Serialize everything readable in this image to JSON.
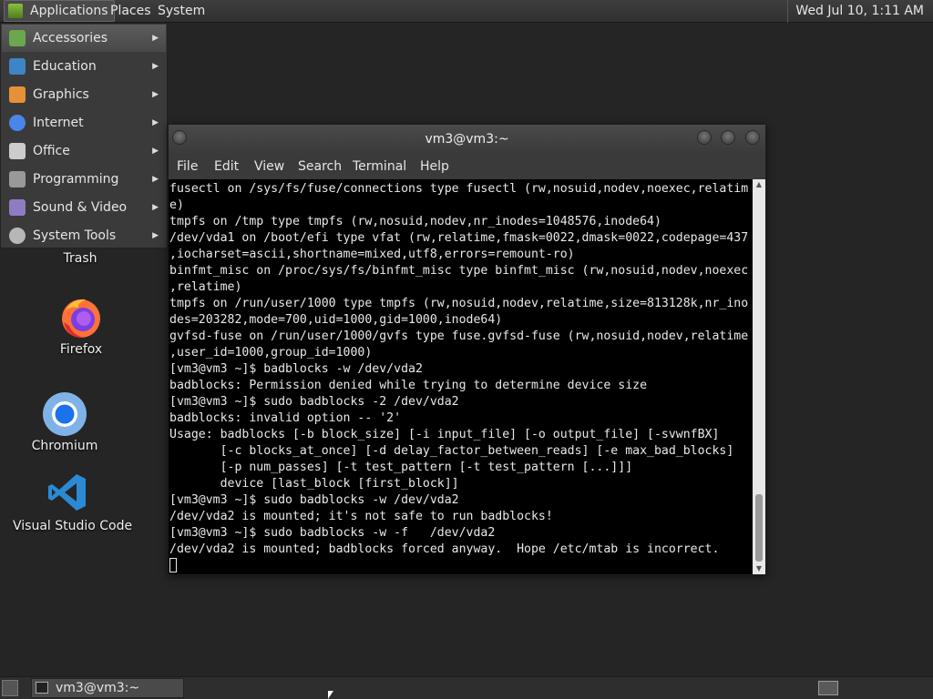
{
  "top_panel": {
    "applications": "Applications",
    "places": "Places",
    "system": "System",
    "clock": "Wed Jul 10,  1:11 AM"
  },
  "app_menu": {
    "items": [
      {
        "label": "Accessories",
        "icon": "accessories-icon",
        "color": "#6aa84f"
      },
      {
        "label": "Education",
        "icon": "education-icon",
        "color": "#3d85c6"
      },
      {
        "label": "Graphics",
        "icon": "graphics-icon",
        "color": "#e69138"
      },
      {
        "label": "Internet",
        "icon": "internet-icon",
        "color": "#4a86e8"
      },
      {
        "label": "Office",
        "icon": "office-icon",
        "color": "#cccccc"
      },
      {
        "label": "Programming",
        "icon": "programming-icon",
        "color": "#999999"
      },
      {
        "label": "Sound & Video",
        "icon": "sound-video-icon",
        "color": "#8e7cc3"
      },
      {
        "label": "System Tools",
        "icon": "system-tools-icon",
        "color": "#b7b7b7"
      }
    ]
  },
  "desktop": {
    "trash": "Trash",
    "firefox": "Firefox",
    "chromium": "Chromium",
    "vscode": "Visual Studio Code"
  },
  "terminal": {
    "title": "vm3@vm3:~",
    "menu": [
      "File",
      "Edit",
      "View",
      "Search",
      "Terminal",
      "Help"
    ],
    "lines": [
      "fusectl on /sys/fs/fuse/connections type fusectl (rw,nosuid,nodev,noexec,relatim",
      "e)",
      "tmpfs on /tmp type tmpfs (rw,nosuid,nodev,nr_inodes=1048576,inode64)",
      "/dev/vda1 on /boot/efi type vfat (rw,relatime,fmask=0022,dmask=0022,codepage=437",
      ",iocharset=ascii,shortname=mixed,utf8,errors=remount-ro)",
      "binfmt_misc on /proc/sys/fs/binfmt_misc type binfmt_misc (rw,nosuid,nodev,noexec",
      ",relatime)",
      "tmpfs on /run/user/1000 type tmpfs (rw,nosuid,nodev,relatime,size=813128k,nr_ino",
      "des=203282,mode=700,uid=1000,gid=1000,inode64)",
      "gvfsd-fuse on /run/user/1000/gvfs type fuse.gvfsd-fuse (rw,nosuid,nodev,relatime",
      ",user_id=1000,group_id=1000)",
      "[vm3@vm3 ~]$ badblocks -w /dev/vda2",
      "badblocks: Permission denied while trying to determine device size",
      "[vm3@vm3 ~]$ sudo badblocks -2 /dev/vda2",
      "badblocks: invalid option -- '2'",
      "Usage: badblocks [-b block_size] [-i input_file] [-o output_file] [-svwnfBX]",
      "       [-c blocks_at_once] [-d delay_factor_between_reads] [-e max_bad_blocks]",
      "       [-p num_passes] [-t test_pattern [-t test_pattern [...]]]",
      "       device [last_block [first_block]]",
      "[vm3@vm3 ~]$ sudo badblocks -w /dev/vda2",
      "/dev/vda2 is mounted; it's not safe to run badblocks!",
      "[vm3@vm3 ~]$ sudo badblocks -w -f   /dev/vda2",
      "/dev/vda2 is mounted; badblocks forced anyway.  Hope /etc/mtab is incorrect."
    ]
  },
  "taskbar": {
    "window_label": "vm3@vm3:~"
  }
}
